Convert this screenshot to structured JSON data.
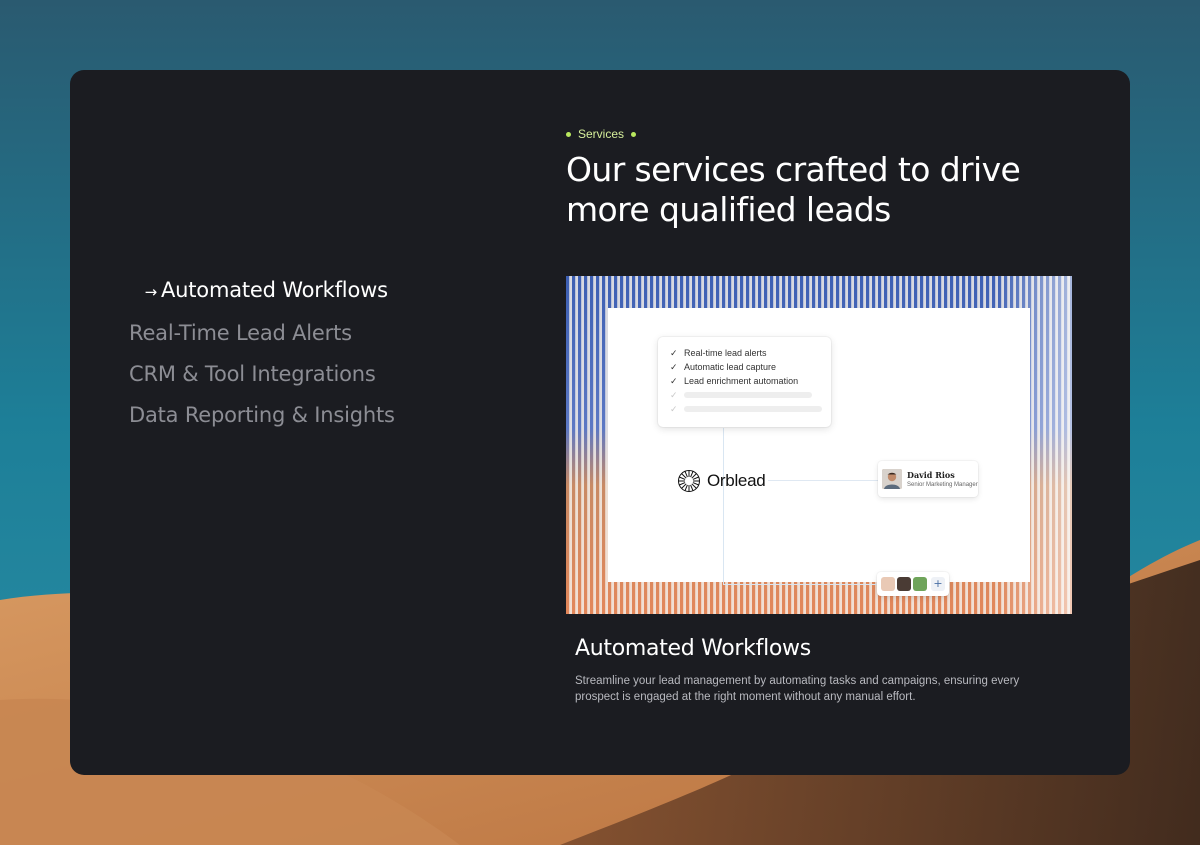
{
  "colors": {
    "card_background": "#1b1c21",
    "accent": "#b9e85e",
    "nav_active": "#ffffff",
    "nav_inactive": "#8c8d94"
  },
  "nav": {
    "active_icon": "arrow-right-icon",
    "items": [
      {
        "label": "Automated Workflows",
        "active": true
      },
      {
        "label": "Real-Time Lead Alerts",
        "active": false
      },
      {
        "label": "CRM & Tool Integrations",
        "active": false
      },
      {
        "label": "Data Reporting & Insights",
        "active": false
      }
    ]
  },
  "header": {
    "eyebrow": "Services",
    "title": "Our services crafted to drive more qualified leads"
  },
  "illustration": {
    "checklist": [
      "Real-time lead alerts",
      "Automatic lead capture",
      "Lead enrichment automation"
    ],
    "brand": "Orblead",
    "profile": {
      "name": "David Rios",
      "role": "Senior Marketing Manager"
    },
    "team_add_icon": "plus-icon"
  },
  "detail": {
    "title": "Automated Workflows",
    "description": "Streamline your lead management by automating tasks and campaigns, ensuring every prospect is engaged at the right moment without any manual effort."
  }
}
